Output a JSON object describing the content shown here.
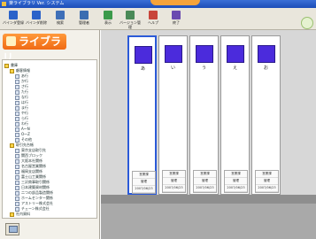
{
  "window": {
    "title": "楽ライブラリ Ver. システム"
  },
  "toolbar": {
    "buttons": [
      {
        "label": "バインダ登録",
        "icon": "binder-register-icon",
        "color": "#2a62c9"
      },
      {
        "label": "バインダ削除",
        "icon": "binder-delete-icon",
        "color": "#2a62c9"
      },
      {
        "label": "検索",
        "icon": "search-icon",
        "color": "#3e6fb8"
      },
      {
        "label": "管理者",
        "icon": "grid-icon",
        "color": "#3a6db1"
      },
      {
        "label": "表示",
        "icon": "display-icon",
        "color": "#3b9a4a"
      },
      {
        "label": "バージョン管理",
        "icon": "version-icon",
        "color": "#4a8a58"
      },
      {
        "label": "ヘルプ",
        "icon": "help-icon",
        "color": "#c8453a"
      },
      {
        "label": "終了",
        "icon": "exit-icon",
        "color": "#6a4ab0"
      }
    ]
  },
  "logo": {
    "text": "ライブラリ"
  },
  "tree": {
    "items": [
      {
        "label": "書庫",
        "level": 0
      },
      {
        "label": "顧客情報",
        "level": 1
      },
      {
        "label": "あ行",
        "level": 2
      },
      {
        "label": "か行",
        "level": 2
      },
      {
        "label": "さ行",
        "level": 2
      },
      {
        "label": "た行",
        "level": 2
      },
      {
        "label": "な行",
        "level": 2
      },
      {
        "label": "は行",
        "level": 2
      },
      {
        "label": "ま行",
        "level": 2
      },
      {
        "label": "や行",
        "level": 2
      },
      {
        "label": "ら行",
        "level": 2
      },
      {
        "label": "わ行",
        "level": 2
      },
      {
        "label": "A～N",
        "level": 2
      },
      {
        "label": "O～Z",
        "level": 2
      },
      {
        "label": "その他",
        "level": 2
      },
      {
        "label": "取引先台帳",
        "level": 1
      },
      {
        "label": "東京支店取引先",
        "level": 2
      },
      {
        "label": "関西ブロック",
        "level": 2
      },
      {
        "label": "大阪本社関係",
        "level": 2
      },
      {
        "label": "名古屋営業関係",
        "level": 2
      },
      {
        "label": "福岡支店関係",
        "level": 2
      },
      {
        "label": "富士山工業関係",
        "level": 2
      },
      {
        "label": "三沢商事取引関係",
        "level": 2
      },
      {
        "label": "日本建築資材関係",
        "level": 2
      },
      {
        "label": "二つの部品製造関係",
        "level": 2
      },
      {
        "label": "ホームセンター関係",
        "level": 2
      },
      {
        "label": "アストリー株式会社",
        "level": 2
      },
      {
        "label": "チェーン株式会社",
        "level": 2
      },
      {
        "label": "社内資料",
        "level": 1
      }
    ]
  },
  "binders": [
    {
      "kana": "あ",
      "dept": "営業課",
      "owner": "管理",
      "date": "2007/06/23"
    },
    {
      "kana": "い",
      "dept": "営業課",
      "owner": "管理",
      "date": "2007/06/23"
    },
    {
      "kana": "う",
      "dept": "営業課",
      "owner": "管理",
      "date": "2007/06/23"
    },
    {
      "kana": "え",
      "dept": "営業課",
      "owner": "管理",
      "date": "2007/06/23"
    },
    {
      "kana": "お",
      "dept": "営業課",
      "owner": "管理",
      "date": "2007/06/23"
    }
  ]
}
